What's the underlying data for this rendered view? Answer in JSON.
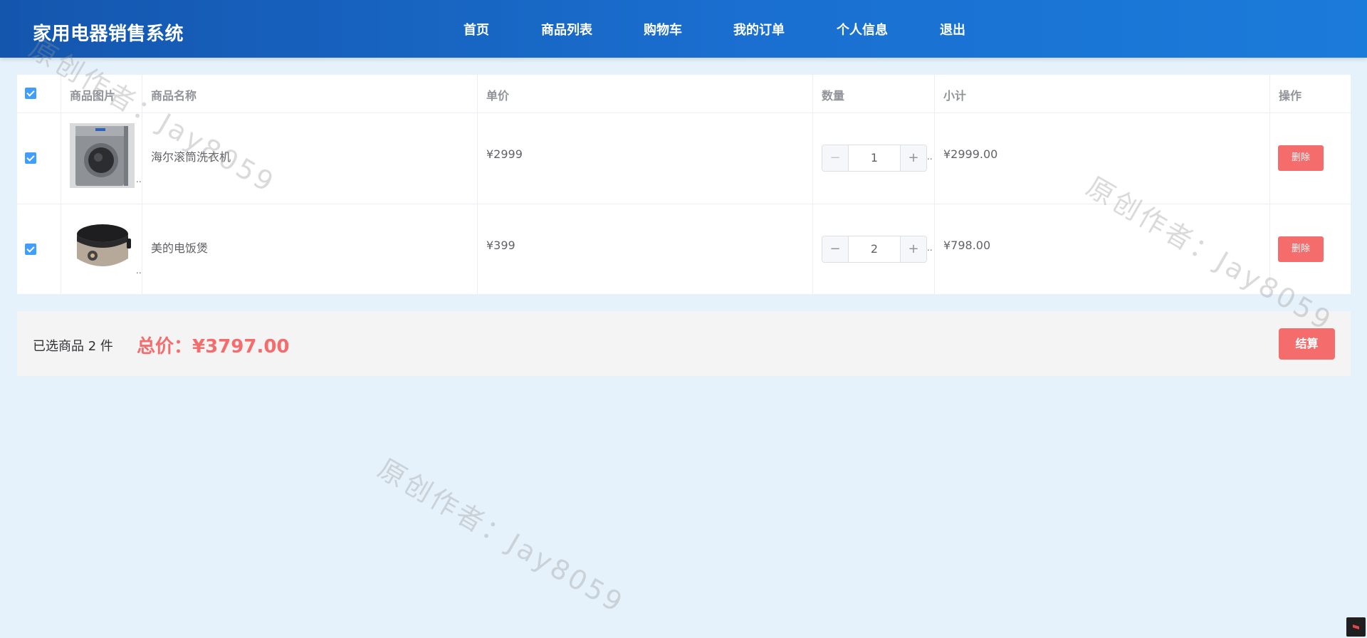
{
  "header": {
    "brand": "家用电器销售系统",
    "nav": [
      {
        "label": "首页"
      },
      {
        "label": "商品列表"
      },
      {
        "label": "购物车"
      },
      {
        "label": "我的订单"
      },
      {
        "label": "个人信息"
      },
      {
        "label": "退出"
      }
    ]
  },
  "cart": {
    "columns": {
      "image": "商品图片",
      "name": "商品名称",
      "price": "单价",
      "quantity": "数量",
      "subtotal": "小计",
      "actions": "操作"
    },
    "select_all_checked": true,
    "rows": [
      {
        "checked": true,
        "image_icon": "washing-machine-icon",
        "name": "海尔滚筒洗衣机",
        "price": "¥2999",
        "quantity": "1",
        "subtotal": "¥2999.00",
        "delete_label": "删除"
      },
      {
        "checked": true,
        "image_icon": "rice-cooker-icon",
        "name": "美的电饭煲",
        "price": "¥399",
        "quantity": "2",
        "subtotal": "¥798.00",
        "delete_label": "删除"
      }
    ],
    "stepper": {
      "minus": "−",
      "plus": "+"
    },
    "overflow_dots": ".."
  },
  "summary": {
    "selected_text": "已选商品 2 件",
    "total_text": "总价：¥3797.00",
    "checkout_label": "结算"
  },
  "watermark": "原创作者：Jay8059",
  "colors": {
    "header_start": "#1456ae",
    "header_end": "#1b7bda",
    "accent_blue": "#409eff",
    "danger_red": "#f56c6c",
    "page_bg": "#e6f2fb"
  }
}
